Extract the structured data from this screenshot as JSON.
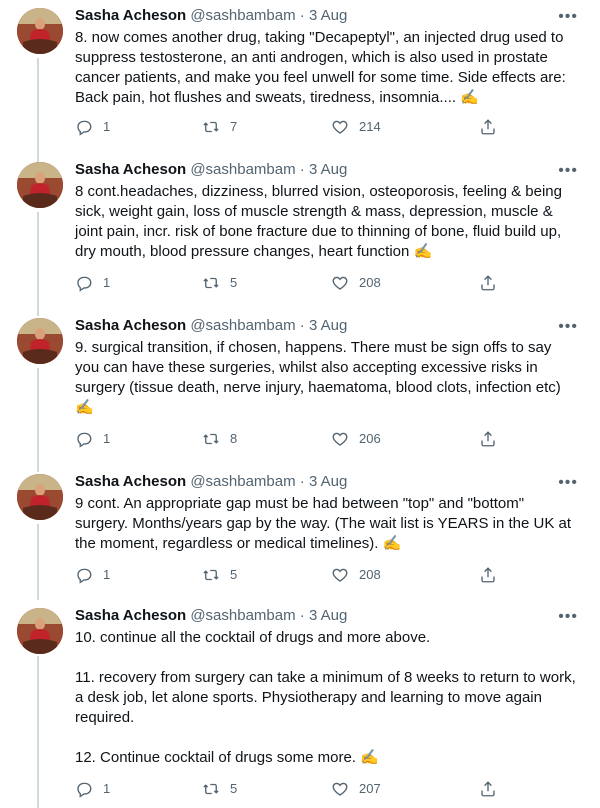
{
  "tweets": [
    {
      "name": "Sasha Acheson",
      "handle": "@sashbambam",
      "sep": " · ",
      "date": "3 Aug",
      "lines": [
        "8. now comes another drug, taking \"Decapeptyl\", an injected drug used to",
        "suppress testosterone, an anti androgen, which is also used in prostate",
        "cancer patients, and make you feel unwell for some time. Side effects are:",
        "Back pain, hot flushes and sweats, tiredness, insomnia.... ✍️"
      ],
      "replies": "1",
      "retweets": "7",
      "likes": "214"
    },
    {
      "name": "Sasha Acheson",
      "handle": "@sashbambam",
      "sep": " · ",
      "date": "3 Aug",
      "lines": [
        "8 cont.headaches, dizziness, blurred vision, osteoporosis, feeling & being",
        "sick, weight gain, loss of muscle strength & mass, depression, muscle &",
        "joint pain, incr. risk of bone fracture due to thinning of bone, fluid build up,",
        "dry mouth, blood pressure changes, heart function ✍️"
      ],
      "replies": "1",
      "retweets": "5",
      "likes": "208"
    },
    {
      "name": "Sasha Acheson",
      "handle": "@sashbambam",
      "sep": " · ",
      "date": "3 Aug",
      "lines": [
        "9. surgical transition, if chosen, happens. There must be sign offs to say",
        "you can have these surgeries, whilst also accepting excessive risks in",
        "surgery (tissue death, nerve injury, haematoma, blood clots, infection etc)",
        "✍️"
      ],
      "replies": "1",
      "retweets": "8",
      "likes": "206"
    },
    {
      "name": "Sasha Acheson",
      "handle": "@sashbambam",
      "sep": " · ",
      "date": "3 Aug",
      "lines": [
        "9 cont. An appropriate gap must be had between \"top\" and \"bottom\"",
        "surgery. Months/years gap by the way. (The wait list is YEARS in the UK at",
        "the moment, regardless or medical timelines). ✍️"
      ],
      "replies": "1",
      "retweets": "5",
      "likes": "208"
    },
    {
      "name": "Sasha Acheson",
      "handle": "@sashbambam",
      "sep": " · ",
      "date": "3 Aug",
      "lines": [
        "10. continue all the cocktail of drugs and more above.",
        "",
        "11. recovery from surgery can take a minimum of 8 weeks to return to work,",
        "a desk job, let alone sports. Physiotherapy and learning to move again",
        "required.",
        "",
        "12. Continue cocktail of drugs some more. ✍️"
      ],
      "replies": "1",
      "retweets": "5",
      "likes": "207"
    }
  ]
}
